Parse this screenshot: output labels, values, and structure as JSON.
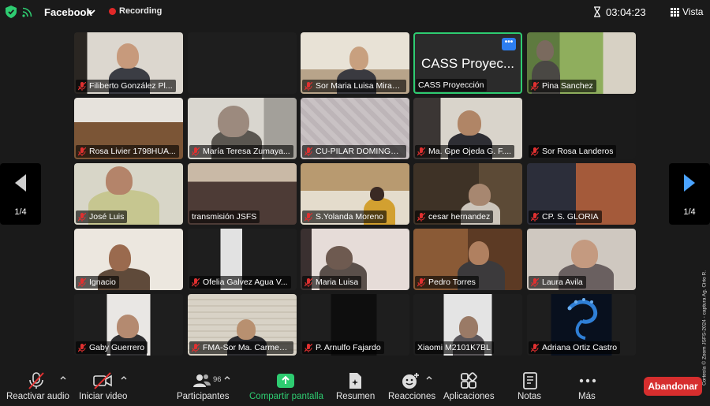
{
  "header": {
    "meeting_title": "Facebook",
    "recording_label": "Recording",
    "timer": "03:04:23",
    "view_label": "Vista"
  },
  "pager": {
    "left_label": "1/4",
    "right_label": "1/4"
  },
  "tiles": [
    {
      "name": "Filiberto González Pl..."
    },
    {
      "name": ""
    },
    {
      "name": "Sor Maria Luisa Miran..."
    },
    {
      "name": "CASS Proyección",
      "big_name": "CASS Proyec..."
    },
    {
      "name": "Pina Sanchez"
    },
    {
      "name": "Rosa  Livier 1798HUA..."
    },
    {
      "name": "María Teresa Zumaya..."
    },
    {
      "name": "CU-PILAR DOMINGU..."
    },
    {
      "name": "Ma. Gpe Ojeda G. F...."
    },
    {
      "name": "Sor Rosa Landeros"
    },
    {
      "name": "José Luis"
    },
    {
      "name": "transmisión JSFS"
    },
    {
      "name": "S.Yolanda Moreno"
    },
    {
      "name": "cesar hernandez"
    },
    {
      "name": "CP. S. GLORIA"
    },
    {
      "name": "Ignacio"
    },
    {
      "name": "Ofelia Galvez  Agua V..."
    },
    {
      "name": "Maria Luisa"
    },
    {
      "name": "Pedro Torres"
    },
    {
      "name": "Laura Avila"
    },
    {
      "name": "Gaby Guerrero"
    },
    {
      "name": "FMA-Sor Ma. Carmen..."
    },
    {
      "name": "P. Arnulfo Fajardo"
    },
    {
      "name": "Xiaomi M2101K7BL"
    },
    {
      "name": "Adriana Ortiz Castro"
    }
  ],
  "toolbar": {
    "audio_label": "Reactivar audio",
    "video_label": "Iniciar video",
    "participants_label": "Participantes",
    "participants_count": "96",
    "share_label": "Compartir pantalla",
    "summary_label": "Resumen",
    "reactions_label": "Reacciones",
    "apps_label": "Aplicaciones",
    "notes_label": "Notas",
    "more_label": "Más",
    "leave_label": "Abandonar"
  },
  "credit": "Cortesía © Zoom JSFS-2024 - captura Ag. Cirio R.",
  "colors": {
    "share_green": "#2ecc71",
    "leave_red": "#d62e2e",
    "active_border": "#2ecc71",
    "muted_red": "#e03030",
    "pager_arrow": "#4aa3ff"
  }
}
